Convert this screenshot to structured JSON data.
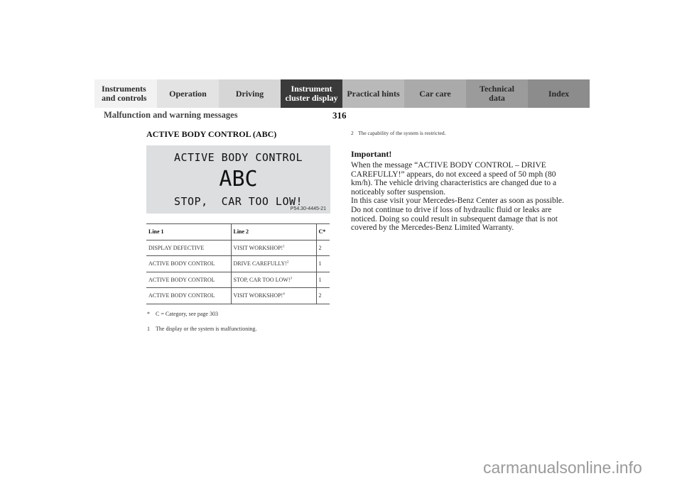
{
  "nav_tabs": [
    {
      "label": "Instruments\nand controls",
      "l1": "Instruments",
      "l2": "and controls"
    },
    {
      "label": "Operation"
    },
    {
      "label": "Driving"
    },
    {
      "label": "Instrument cluster display",
      "l1": "Instrument",
      "l2": "cluster display",
      "active": true
    },
    {
      "label": "Practical hints"
    },
    {
      "label": "Car care"
    },
    {
      "label": "Technical data",
      "l1": "Technical",
      "l2": "data"
    },
    {
      "label": "Index"
    }
  ],
  "header": {
    "title": "Malfunction and warning messages",
    "page_number": "316"
  },
  "section": {
    "title": "ACTIVE BODY CONTROL (ABC)"
  },
  "display": {
    "line1": "ACTIVE BODY CONTROL",
    "line2": "ABC",
    "line3": "STOP,  CAR TOO LOW!",
    "figure_code": "P54.30-4445-21"
  },
  "table": {
    "headers": [
      "Line 1",
      "Line 2",
      "C*"
    ],
    "rows": [
      {
        "line1": "DISPLAY DEFECTIVE",
        "line2": "VISIT WORKSHOP!",
        "note": "1",
        "category": "2"
      },
      {
        "line1": "ACTIVE BODY CONTROL",
        "line2": "DRIVE CAREFULLY!",
        "note": "2",
        "category": "1"
      },
      {
        "line1": "ACTIVE BODY CONTROL",
        "line2": "STOP, CAR TOO LOW!",
        "note": "3",
        "category": "1"
      },
      {
        "line1": "ACTIVE BODY CONTROL",
        "line2": "VISIT WORKSHOP!",
        "note": "4",
        "category": "2"
      }
    ]
  },
  "footnotes": [
    {
      "mark": "*",
      "text": "C = Category, see page 303"
    },
    {
      "mark": "1",
      "text": "The display or the system is malfunctioning."
    },
    {
      "mark": "2",
      "text": "The capability of the system is restricted."
    }
  ],
  "important": {
    "heading": "Important!",
    "paragraphs": [
      "When the message “ACTIVE BODY CONTROL – DRIVE CAREFULLY!” appears, do not exceed a speed of 50 mph (80 km/h). The vehicle driving characteristics are changed due to a noticeably softer suspension.",
      "In this case visit your Mercedes-Benz Center as soon as possible.",
      "Do not continue to drive if loss of hydraulic fluid or leaks are noticed. Doing so could result in subsequent damage that is not covered by the Mercedes-Benz Limited Warranty."
    ]
  },
  "watermark": "carmanualsonline.info"
}
